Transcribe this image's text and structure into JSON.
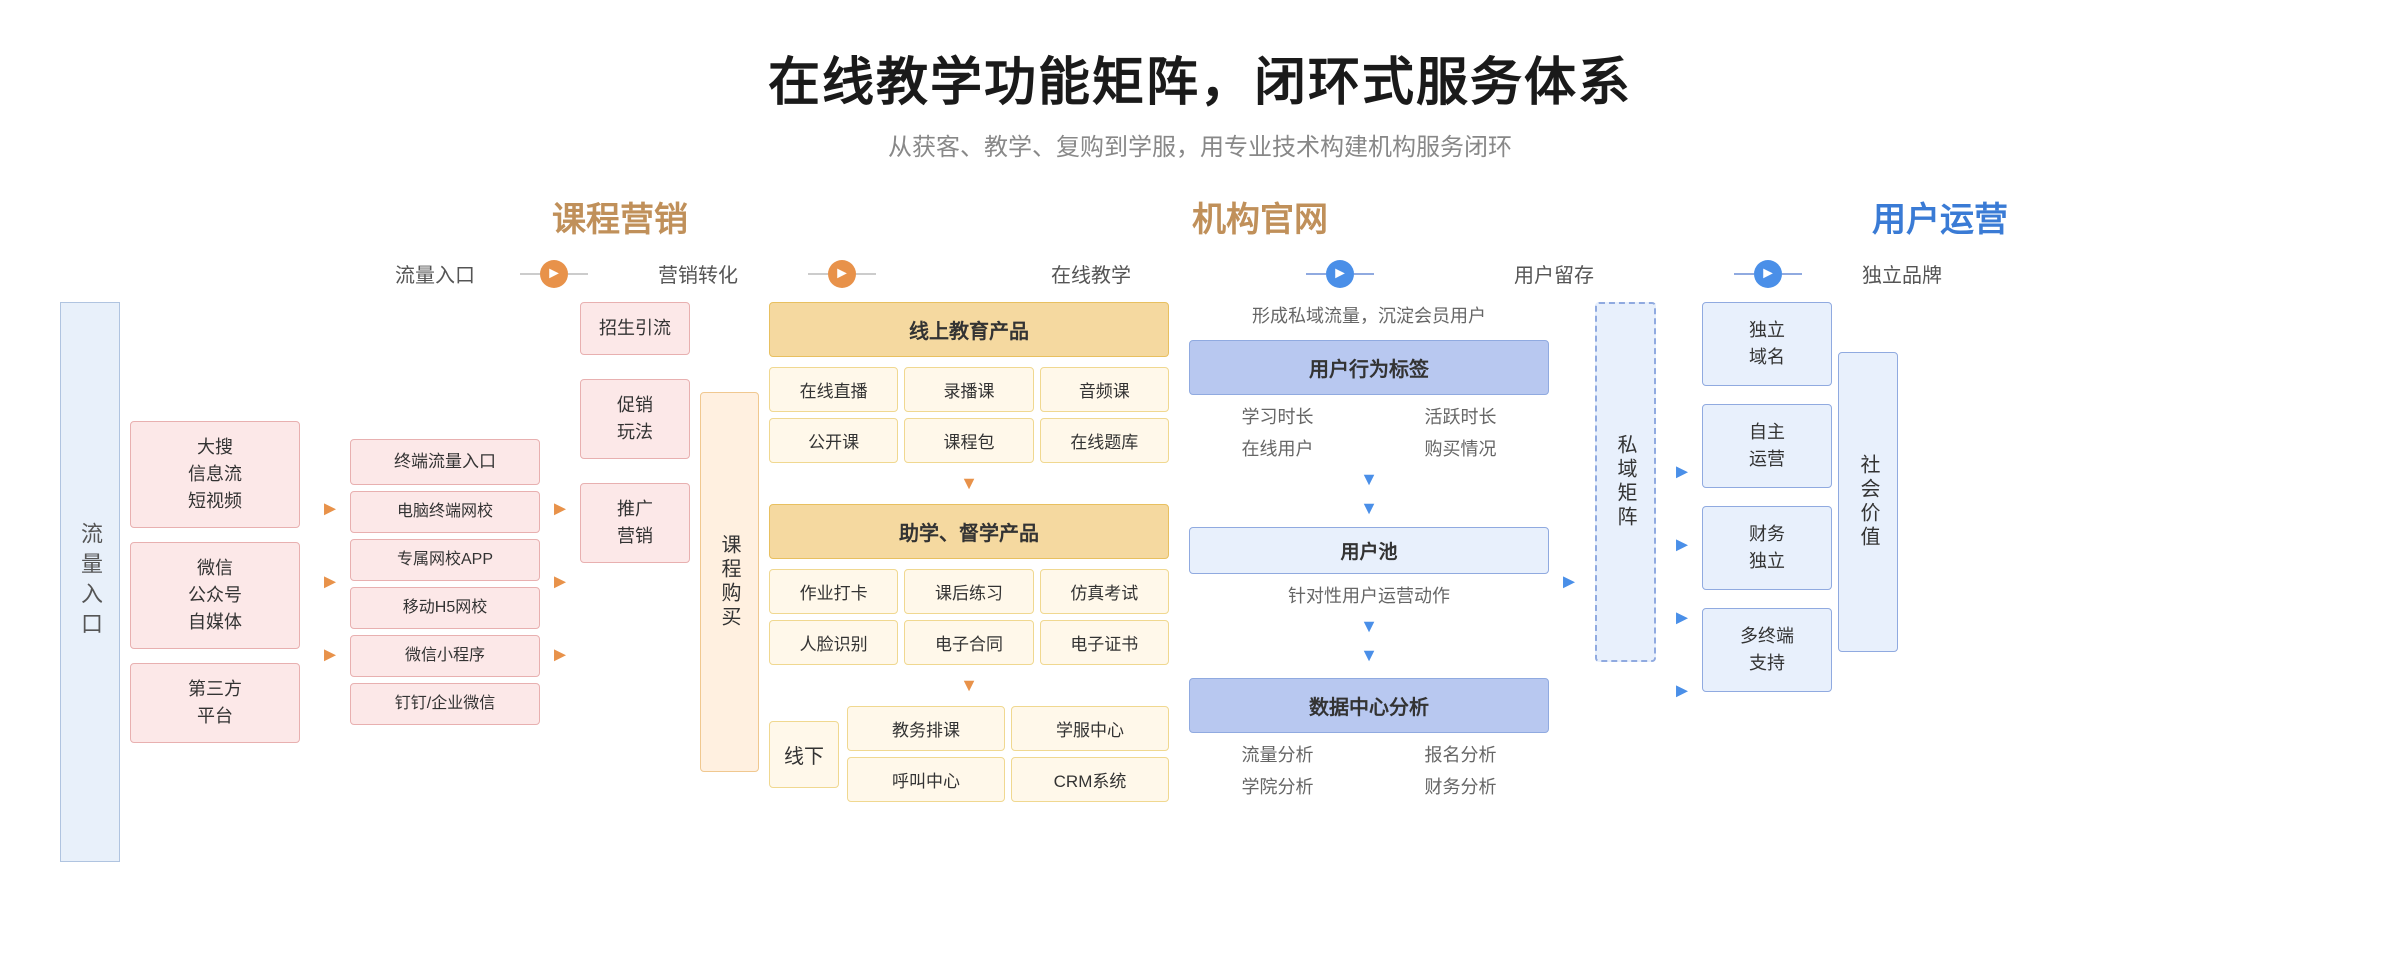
{
  "header": {
    "title": "在线教学功能矩阵，闭环式服务体系",
    "subtitle": "从获客、教学、复购到学服，用专业技术构建机构服务闭环"
  },
  "categories": {
    "kecheng": "课程营销",
    "jigou": "机构官网",
    "yonghu": "用户运营"
  },
  "flow_labels": {
    "liuliang": "流量入口",
    "yingxiao": "营销转化",
    "zaixian": "在线教学",
    "yonghu": "用户留存",
    "pinpai": "独立品牌"
  },
  "left_label": "流量入口",
  "traffic_sources": [
    "大搜\n信息流\n短视频",
    "微信\n公众号\n自媒体",
    "第三方\n平台"
  ],
  "mkt_items": [
    "终端流量入口",
    "电脑终端网校",
    "专属网校APP",
    "移动H5网校",
    "微信小程序",
    "钉钉/企业微信"
  ],
  "arrow1": "►",
  "sales_items": [
    "招生引流",
    "促销\n玩法",
    "推广\n营销"
  ],
  "vertical_purchase": "课程购买",
  "online_edu": {
    "header": "线上教育产品",
    "items": [
      "在线直播",
      "录播课",
      "音频课",
      "公开课",
      "课程包",
      "在线题库"
    ]
  },
  "assist_edu": {
    "header": "助学、督学产品",
    "items": [
      "作业打卡",
      "课后练习",
      "仿真考试",
      "人脸识别",
      "电子合同",
      "电子证书"
    ]
  },
  "offline": {
    "label": "线下",
    "items": [
      "教务排课",
      "学服中心",
      "呼叫中心",
      "CRM系统"
    ]
  },
  "user_zone": {
    "note": "形成私域流量，沉淀会员用户",
    "tag_header": "用户行为标签",
    "tag_items": [
      "学习时长",
      "活跃时长",
      "在线用户",
      "购买情况"
    ],
    "pool_header": "用户池",
    "pool_sub": "针对性用户运营动作",
    "data_header": "数据中心分析",
    "data_items": [
      "流量分析",
      "报名分析",
      "学院分析",
      "财务分析"
    ]
  },
  "private_label": "私域矩阵",
  "brand_items": [
    "独立\n域名",
    "自主\n运营",
    "财务\n独立",
    "多终端\n支持"
  ],
  "social_label": "社会价值"
}
